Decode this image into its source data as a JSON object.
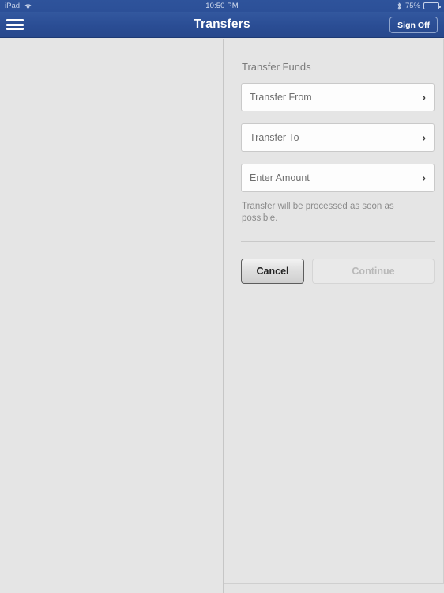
{
  "status_bar": {
    "device": "iPad",
    "wifi_icon": "wifi-icon",
    "time": "10:50 PM",
    "bluetooth_icon": "bluetooth-icon",
    "battery_percent": "75%",
    "battery_level": 75
  },
  "nav_bar": {
    "menu_icon": "hamburger-menu-icon",
    "title": "Transfers",
    "sign_off_label": "Sign Off"
  },
  "form": {
    "section_title": "Transfer Funds",
    "fields": [
      {
        "label": "Transfer From",
        "value": "",
        "chevron": "›"
      },
      {
        "label": "Transfer To",
        "value": "",
        "chevron": "›"
      },
      {
        "label": "Enter Amount",
        "value": "",
        "chevron": "›"
      }
    ],
    "helper_text": "Transfer will be processed as soon as possible.",
    "cancel_label": "Cancel",
    "continue_label": "Continue"
  },
  "colors": {
    "nav_blue": "#2c5098",
    "panel_bg": "#e5e5e5",
    "field_bg": "#fdfdfd",
    "text_muted": "#7a7a7a"
  }
}
